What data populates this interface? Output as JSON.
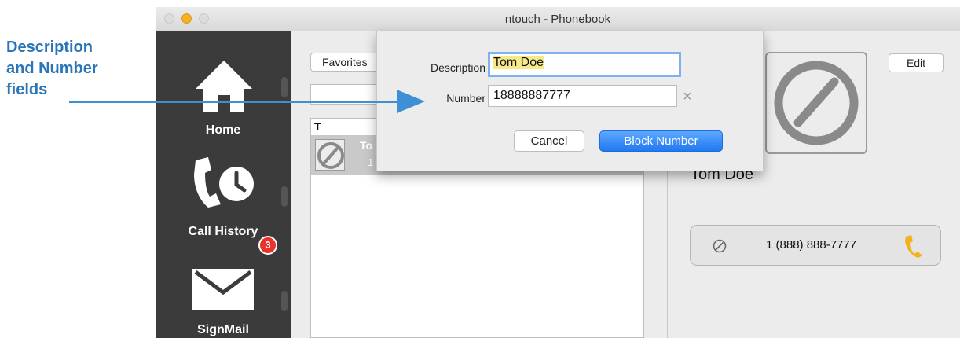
{
  "callout": {
    "lines": [
      "Description",
      "and Number",
      "fields"
    ]
  },
  "window": {
    "title": "ntouch - Phonebook"
  },
  "sidebar": {
    "items": [
      {
        "label": "Home",
        "icon": "home-icon"
      },
      {
        "label": "Call History",
        "icon": "call-history-icon"
      },
      {
        "label": "SignMail",
        "icon": "mail-icon",
        "badge": "3"
      }
    ]
  },
  "list_panel": {
    "favorites_label": "Favorites",
    "header": "T",
    "rows": [
      {
        "name": "To",
        "number": "1"
      }
    ]
  },
  "detail": {
    "edit_label": "Edit",
    "contact_name": "Tom Doe",
    "phone": "1 (888) 888-7777"
  },
  "dialog": {
    "description_label": "Description",
    "description_value": "Tom Doe",
    "number_label": "Number",
    "number_value": "18888887777",
    "clear_symbol": "×",
    "cancel_label": "Cancel",
    "block_label": "Block Number"
  },
  "colors": {
    "callout": "#2a75b8",
    "sidebar": "#3b3b3b",
    "primary_button": "#2278f0",
    "badge": "#e8322b",
    "phone_icon": "#f2b21c"
  }
}
